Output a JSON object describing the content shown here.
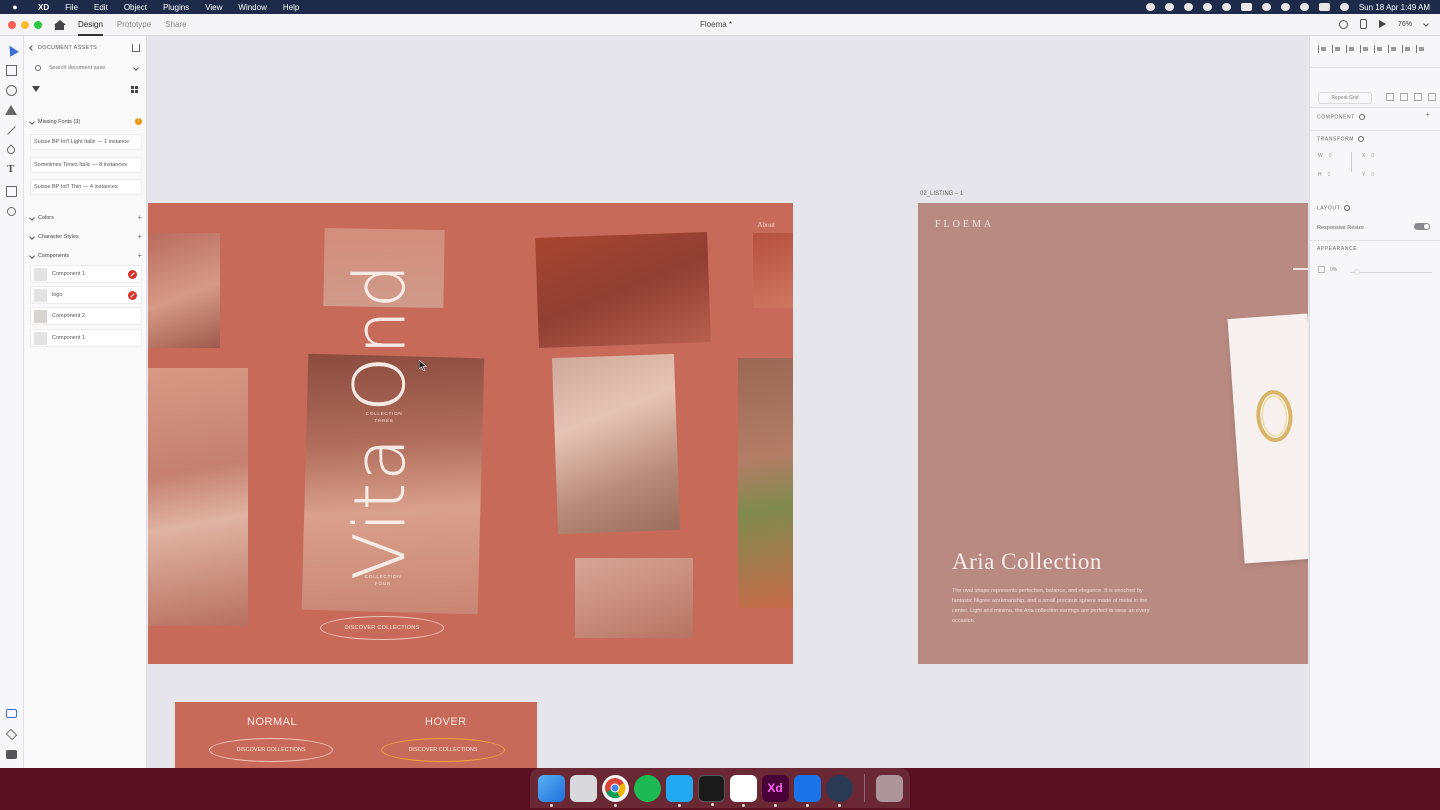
{
  "menubar": {
    "app_name": "XD",
    "menus": [
      "File",
      "Edit",
      "Object",
      "Plugins",
      "View",
      "Window",
      "Help"
    ],
    "datetime": "Sun 18 Apr  1:49 AM"
  },
  "titlebar": {
    "tabs": [
      "Design",
      "Prototype",
      "Share"
    ],
    "active_tab": "Design",
    "document_title": "Floema *",
    "zoom": "76%"
  },
  "assets_panel": {
    "header": "DOCUMENT ASSETS",
    "search_placeholder": "Search document asse",
    "missing_fonts_label": "Missing Fonts (3)",
    "missing_fonts": [
      "Suisse BP Int'l Light Italic — 1 instance",
      "Sometimes Times Italic — 8 instances",
      "Suisse BP Int'l Thin — 4 instances"
    ],
    "sections": {
      "colors": "Colors",
      "character_styles": "Character Styles",
      "components": "Components"
    },
    "components": [
      {
        "label": "Component 1",
        "badge": true
      },
      {
        "label": "logo",
        "badge": true
      },
      {
        "label": "Component 2",
        "badge": false
      },
      {
        "label": "Component 1",
        "badge": false
      }
    ]
  },
  "canvas": {
    "artboard1": {
      "about_link": "About",
      "title": "Vita Ond",
      "collection_three": "COLLECTION\nTHREE",
      "collection_four": "COLLECTION\nFOUR",
      "button": "DISCOVER COLLECTIONS"
    },
    "artboard2": {
      "label": "02_LISTING – 1",
      "logo": "FLOEMA",
      "title": "Aria Collection",
      "description": "The oval shape represents perfection, balance, and elegance. It is enriched by fantastic filigree workmanship, and a small precious sphere made of metal in the center. Light and minima, the Aria collection earrings are perfect to wear an every occasion."
    },
    "artboard3": {
      "normal_label": "NORMAL",
      "hover_label": "HOVER",
      "normal_button": "DISCOVER COLLECTIONS",
      "hover_button": "DISCOVER COLLECTIONS"
    }
  },
  "inspector": {
    "repeat_grid": "Repeat Grid",
    "component": "COMPONENT",
    "transform": "TRANSFORM",
    "fields": {
      "w": "W",
      "w_val": "0",
      "h": "H",
      "h_val": "0",
      "x": "X",
      "x_val": "0",
      "y": "Y",
      "y_val": "0"
    },
    "layout": "LAYOUT",
    "responsive_resize": "Responsive Resize",
    "responsive_resize_on": true,
    "appearance": "APPEARANCE",
    "opacity": "0%"
  },
  "dock": {
    "apps": [
      "Finder",
      "Launchpad",
      "Chrome",
      "Spotify",
      "VS Code",
      "Terminal",
      "Slack",
      "Adobe XD",
      "Maps",
      "Safari",
      "Trash"
    ]
  },
  "colors": {
    "artboard_coral": "#c86a5a",
    "artboard_rose": "#b88a82",
    "accent_blue": "#3b6fd6",
    "warning_orange": "#f0960a",
    "badge_red": "#d9322a"
  }
}
